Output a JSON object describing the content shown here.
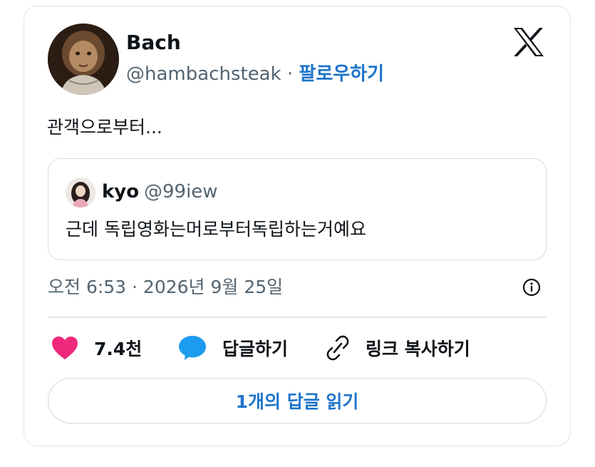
{
  "author": {
    "name": "Bach",
    "handle": "@hambachsteak",
    "separator": "·",
    "follow_label": "팔로우하기"
  },
  "tweet": {
    "text": "관객으로부터..."
  },
  "quoted": {
    "name": "kyo",
    "handle": "@99iew",
    "text": "근데 독립영화는머로부터독립하는거예요"
  },
  "timestamp": "오전 6:53 · 2026년 9월 25일",
  "actions": {
    "like_count": "7.4천",
    "reply_label": "답글하기",
    "copy_link_label": "링크 복사하기"
  },
  "read_replies_label": "1개의 답글 읽기",
  "icons": {
    "logo": "x-logo-icon",
    "like": "heart-icon",
    "reply": "speech-bubble-icon",
    "link": "link-icon",
    "info": "info-icon"
  },
  "colors": {
    "accent": "#1d74c9",
    "like": "#f0287b",
    "reply": "#1d9bf0",
    "muted": "#536471"
  }
}
